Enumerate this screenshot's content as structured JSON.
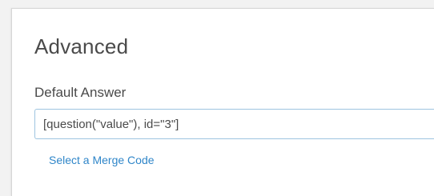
{
  "advanced": {
    "title": "Advanced",
    "default_answer_label": "Default Answer",
    "default_answer_value": "[question(\"value\"), id=\"3\"]",
    "merge_code_link": "Select a Merge Code"
  },
  "colors": {
    "link": "#2f86c9",
    "input_border": "#9ec4e0",
    "text": "#4a4a4a"
  }
}
